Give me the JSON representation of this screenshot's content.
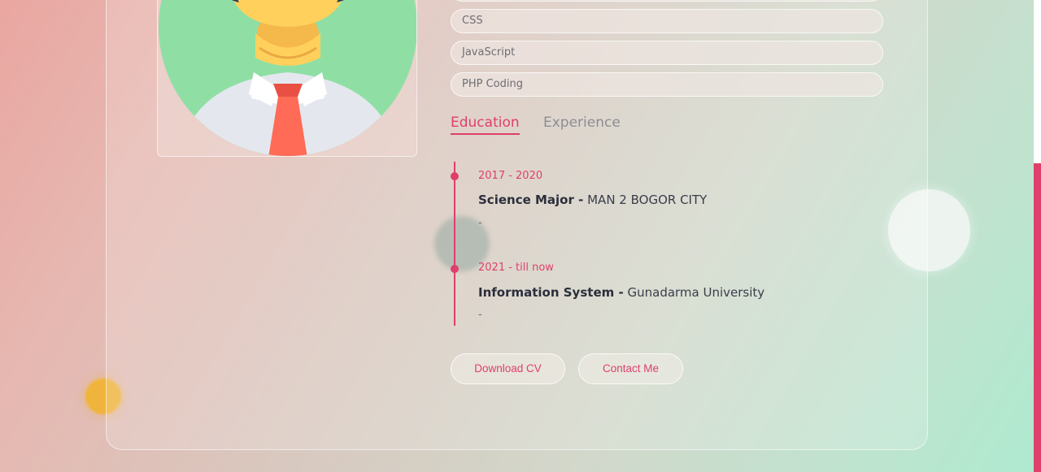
{
  "skills": [
    {
      "label": ""
    },
    {
      "label": "CSS"
    },
    {
      "label": "JavaScript"
    },
    {
      "label": "PHP Coding"
    }
  ],
  "tabs": {
    "education": "Education",
    "experience": "Experience"
  },
  "timeline": [
    {
      "date": "2017 - 2020",
      "title": "Science Major -",
      "place": "MAN 2 BOGOR CITY",
      "desc": "-"
    },
    {
      "date": "2021 - till now",
      "title": "Information System -",
      "place": "Gunadarma University",
      "desc": "-"
    }
  ],
  "buttons": {
    "download_cv": "Download CV",
    "contact_me": "Contact Me"
  },
  "colors": {
    "accent": "#df3f6b",
    "avatar_bg": "#8fdfa5",
    "skin": "#ffd15c",
    "tie": "#ff6b57"
  }
}
